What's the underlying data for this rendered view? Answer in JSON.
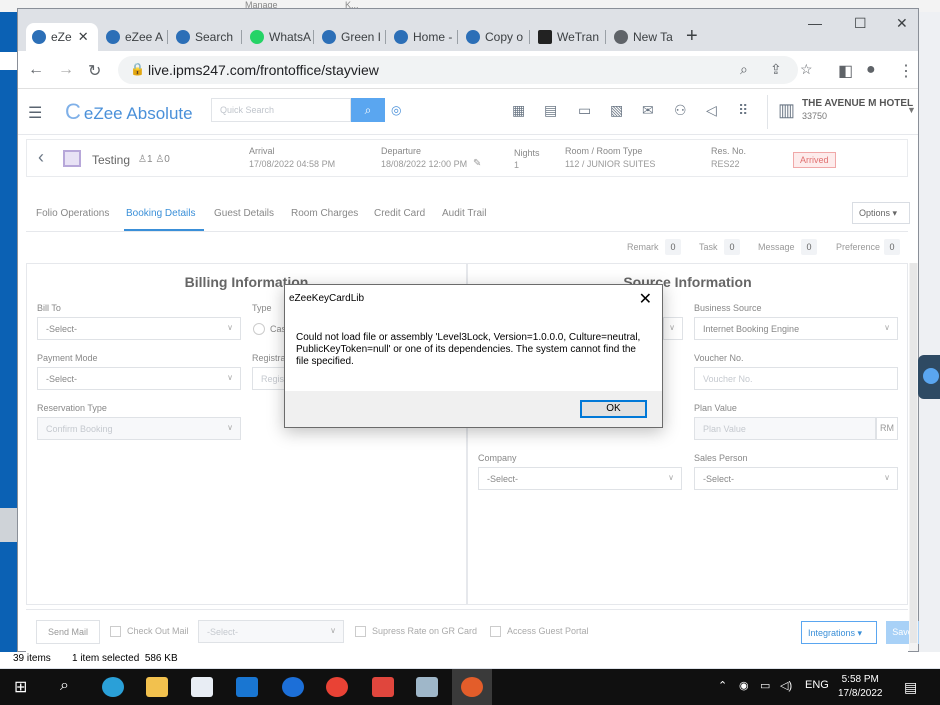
{
  "desktop_top": {
    "ghost_text_1": "Manage",
    "ghost_text_2": "K..."
  },
  "browser": {
    "tabs": [
      {
        "label": "eZe",
        "fav_color": "#2c6fb7"
      },
      {
        "label": "eZee A",
        "fav_color": "#2c6fb7"
      },
      {
        "label": "Search",
        "fav_color": "#2c6fb7"
      },
      {
        "label": "WhatsA",
        "fav_color": "#25d366"
      },
      {
        "label": "Green I",
        "fav_color": "#2c6fb7"
      },
      {
        "label": "Home -",
        "fav_color": "#2c6fb7"
      },
      {
        "label": "Copy o",
        "fav_color": "#2c6fb7"
      },
      {
        "label": "WeTran",
        "fav_color": "#222222"
      },
      {
        "label": "New Ta",
        "fav_color": "#5f6368"
      }
    ],
    "url": "live.ipms247.com/frontoffice/stayview"
  },
  "app": {
    "logo": "eZee Absolute",
    "search_placeholder": "Quick Search",
    "hotel_name": "THE AVENUE M HOTEL",
    "hotel_code": "33750"
  },
  "reservation": {
    "guest_name": "Testing",
    "adults": "1",
    "children": "0",
    "arrival_label": "Arrival",
    "arrival_value": "17/08/2022 04:58 PM",
    "departure_label": "Departure",
    "departure_value": "18/08/2022 12:00 PM",
    "nights_label": "Nights",
    "nights_value": "1",
    "room_label": "Room / Room Type",
    "room_value": "112 / JUNIOR SUITES",
    "resno_label": "Res. No.",
    "resno_value": "RES22",
    "status": "Arrived"
  },
  "subtabs": [
    "Folio Operations",
    "Booking Details",
    "Guest Details",
    "Room Charges",
    "Credit Card",
    "Audit Trail"
  ],
  "options_label": "Options",
  "counts": [
    {
      "label": "Remark",
      "value": "0"
    },
    {
      "label": "Task",
      "value": "0"
    },
    {
      "label": "Message",
      "value": "0"
    },
    {
      "label": "Preference",
      "value": "0"
    }
  ],
  "billing": {
    "title": "Billing Information",
    "bill_to_label": "Bill To",
    "bill_to_value": "-Select-",
    "type_label": "Type",
    "type_option": "Cas",
    "payment_mode_label": "Payment Mode",
    "payment_mode_value": "-Select-",
    "registration_label": "Registrat",
    "registration_placeholder": "Regis",
    "reservation_type_label": "Reservation Type",
    "reservation_type_value": "Confirm Booking"
  },
  "source": {
    "title": "Source Information",
    "business_source_label": "Business Source",
    "business_source_value": "Internet Booking Engine",
    "voucher_label": "Voucher No.",
    "voucher_placeholder": "Voucher No.",
    "plan_value_label": "Plan Value",
    "plan_value_placeholder": "Plan Value",
    "currency": "RM",
    "company_label": "Company",
    "company_value": "-Select-",
    "sales_person_label": "Sales Person",
    "sales_person_value": "-Select-"
  },
  "footer": {
    "send_mail": "Send Mail",
    "check_out_mail": "Check Out Mail",
    "check_out_select": "-Select-",
    "supress_rate": "Supress Rate on GR Card",
    "access_portal": "Access Guest Portal",
    "integrations": "Integrations",
    "save": "Save"
  },
  "dialog": {
    "title": "eZeeKeyCardLib",
    "message": "Could not load file or assembly 'Level3Lock, Version=1.0.0.0, Culture=neutral, PublicKeyToken=null' or one of its dependencies. The system cannot find the file specified.",
    "ok": "OK"
  },
  "statusbar": {
    "items": "39 items",
    "selected": "1 item selected  586 KB"
  },
  "taskbar": {
    "lang": "ENG",
    "time": "5:58 PM",
    "date": "17/8/2022"
  }
}
